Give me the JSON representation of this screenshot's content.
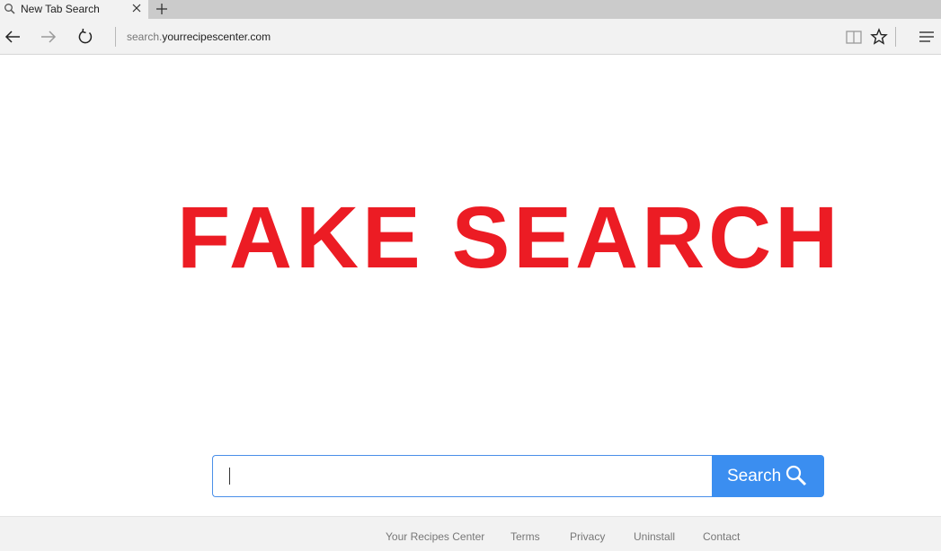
{
  "browser": {
    "tab_title": "New Tab Search",
    "url_prefix": "search.",
    "url_domain": "yourrecipescenter.com",
    "icons": {
      "tab": "search-icon",
      "close": "close-icon",
      "new_tab": "plus-icon",
      "back": "arrow-left-icon",
      "forward": "arrow-right-icon",
      "refresh": "refresh-icon",
      "reading_view": "book-icon",
      "favorite": "star-icon",
      "menu": "hamburger-icon"
    }
  },
  "main": {
    "headline": "FAKE SEARCH",
    "headline_color": "#ec1c24",
    "search": {
      "value": "",
      "button_label": "Search",
      "button_color": "#3b8ef0"
    }
  },
  "footer": {
    "links": [
      "Your Recipes Center",
      "Terms",
      "Privacy",
      "Uninstall",
      "Contact"
    ]
  }
}
